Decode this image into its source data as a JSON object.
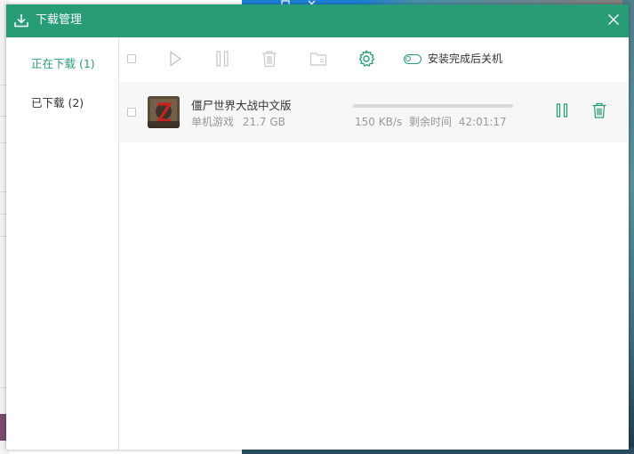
{
  "window": {
    "title": "下载管理",
    "accent": "#279c76"
  },
  "sidebar": {
    "items": [
      {
        "label": "正在下载 (1)",
        "active": true
      },
      {
        "label": "已下载 (2)",
        "active": false
      }
    ]
  },
  "toolbar": {
    "icons": [
      "checkbox-icon",
      "play-icon",
      "pause-icon",
      "delete-icon",
      "folder-icon",
      "settings-icon"
    ],
    "shutdown_label": "安装完成后关机"
  },
  "downloads": [
    {
      "name": "僵尸世界大战中文版",
      "category": "单机游戏",
      "size": "21.7 GB",
      "speed": "150 KB/s",
      "time_label": "剩余时间",
      "time_remaining": "42:01:17",
      "progress": 0
    }
  ]
}
